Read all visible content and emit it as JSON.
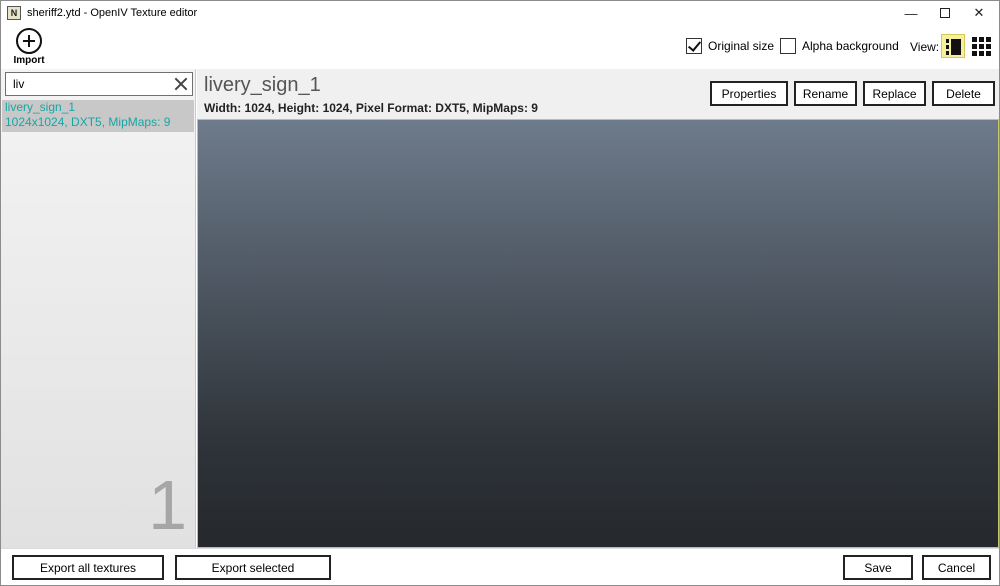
{
  "window": {
    "title": "sheriff2.ytd - OpenIV Texture editor",
    "app_icon_glyph": "N",
    "minimize_glyph": "—",
    "close_glyph": "✕"
  },
  "toolbar": {
    "import_label": "Import",
    "original_size_label": "Original size",
    "original_size_checked": true,
    "alpha_background_label": "Alpha background",
    "alpha_background_checked": false,
    "view_label": "View:",
    "active_view": "list"
  },
  "search": {
    "value": "liv"
  },
  "texture_list": {
    "items": [
      {
        "name": "livery_sign_1",
        "info": "1024x1024, DXT5, MipMaps: 9"
      }
    ],
    "count": "1"
  },
  "selected_texture": {
    "name": "livery_sign_1",
    "details": "Width: 1024, Height: 1024, Pixel Format: DXT5, MipMaps: 9"
  },
  "actions": {
    "properties": "Properties",
    "rename": "Rename",
    "replace": "Replace",
    "delete": "Delete"
  },
  "footer": {
    "export_all": "Export all textures",
    "export_selected": "Export selected",
    "save": "Save",
    "cancel": "Cancel"
  },
  "colors": {
    "accent_list_text": "#16a6a6",
    "view_active_bg": "#f7ef9b",
    "preview_top": "#6e7b8b",
    "preview_bottom": "#25282c"
  }
}
